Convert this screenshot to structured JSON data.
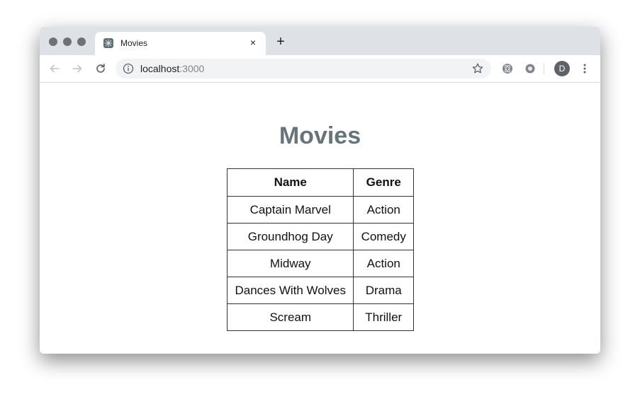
{
  "browser": {
    "tab": {
      "title": "Movies",
      "favicon": "page-favicon-icon"
    },
    "new_tab_label": "+",
    "close_label": "×",
    "address": {
      "host": "localhost",
      "port": ":3000"
    },
    "profile_initial": "D"
  },
  "page": {
    "title": "Movies",
    "table": {
      "headers": [
        "Name",
        "Genre"
      ],
      "rows": [
        [
          "Captain Marvel",
          "Action"
        ],
        [
          "Groundhog Day",
          "Comedy"
        ],
        [
          "Midway",
          "Action"
        ],
        [
          "Dances With Wolves",
          "Drama"
        ],
        [
          "Scream",
          "Thriller"
        ]
      ]
    }
  },
  "colors": {
    "title": "#68737a",
    "tabstrip": "#dee1e6",
    "omnibox": "#f1f3f4"
  }
}
